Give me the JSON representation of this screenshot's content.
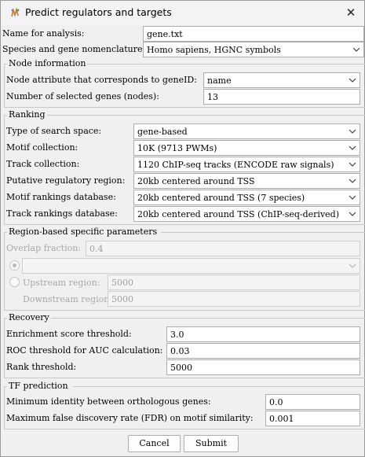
{
  "window": {
    "title": "Predict regulators and targets",
    "close_glyph": "✕",
    "icon": "app-icon"
  },
  "analysis": {
    "name_label": "Name for analysis:",
    "name_value": "gene.txt",
    "species_label": "Species and gene nomenclature:",
    "species_value": "Homo sapiens, HGNC symbols"
  },
  "node_info": {
    "title": "Node information",
    "attr_label": "Node attribute that corresponds to geneID:",
    "attr_value": "name",
    "num_label": "Number of selected genes (nodes):",
    "num_value": "13"
  },
  "ranking": {
    "title": "Ranking",
    "search_label": "Type of search space:",
    "search_value": "gene-based",
    "motif_label": "Motif collection:",
    "motif_value": "10K (9713 PWMs)",
    "track_label": "Track collection:",
    "track_value": "1120 ChIP-seq tracks (ENCODE raw signals)",
    "region_label": "Putative regulatory region:",
    "region_value": "20kb centered around TSS",
    "motif_db_label": "Motif rankings database:",
    "motif_db_value": "20kb centered around TSS (7 species)",
    "track_db_label": "Track rankings database:",
    "track_db_value": "20kb centered around TSS (ChIP-seq-derived)"
  },
  "region_params": {
    "title": "Region-based specific parameters",
    "overlap_label": "Overlap fraction:",
    "overlap_value": "0.4",
    "upstream_label": "Upstream region:",
    "upstream_value": "5000",
    "downstream_label": "Downstream region:",
    "downstream_value": "5000"
  },
  "recovery": {
    "title": "Recovery",
    "enrich_label": "Enrichment score threshold:",
    "enrich_value": "3.0",
    "roc_label": "ROC threshold for AUC calculation:",
    "roc_value": "0.03",
    "rank_label": "Rank threshold:",
    "rank_value": "5000"
  },
  "tf_prediction": {
    "title": "TF prediction",
    "min_identity_label": "Minimum identity between orthologous genes:",
    "min_identity_value": "0.0",
    "fdr_label": "Maximum false discovery rate (FDR) on motif similarity:",
    "fdr_value": "0.001"
  },
  "buttons": {
    "cancel": "Cancel",
    "submit": "Submit"
  }
}
